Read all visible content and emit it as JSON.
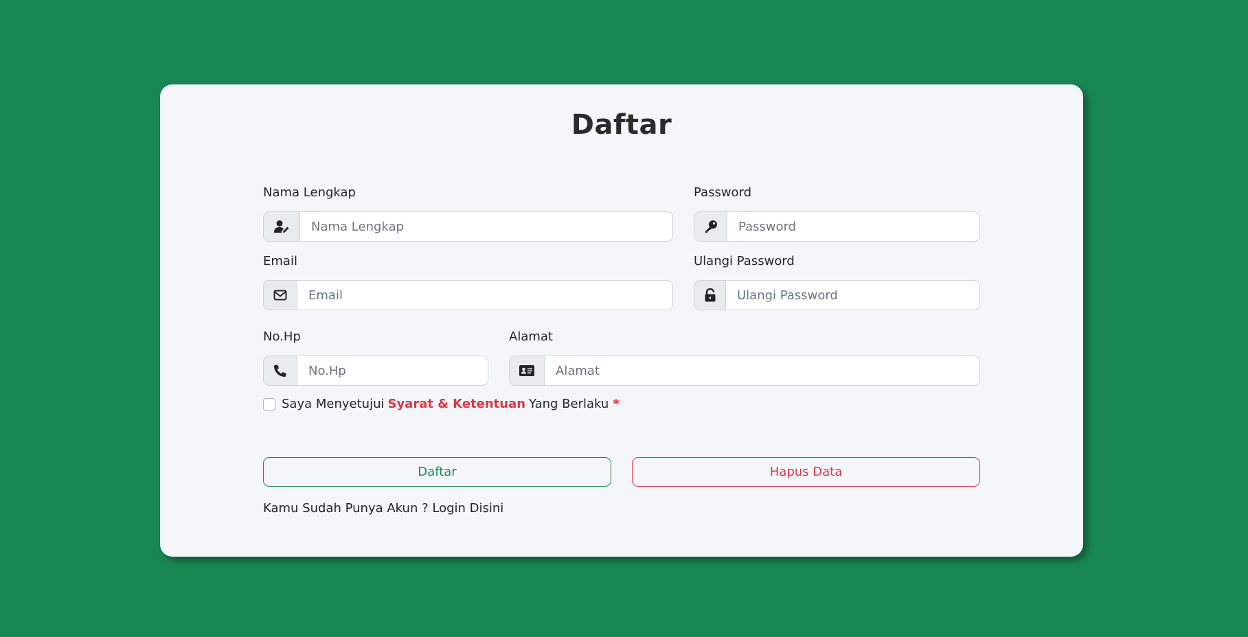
{
  "form": {
    "title": "Daftar",
    "fields": {
      "nama": {
        "label": "Nama Lengkap",
        "placeholder": "Nama Lengkap",
        "icon": "user-pen-icon"
      },
      "password": {
        "label": "Password",
        "placeholder": "Password",
        "icon": "key-icon"
      },
      "email": {
        "label": "Email",
        "placeholder": "Email",
        "icon": "envelope-icon"
      },
      "ulangi": {
        "label": "Ulangi Password",
        "placeholder": "Ulangi Password",
        "icon": "unlock-icon"
      },
      "nohp": {
        "label": "No.Hp",
        "placeholder": "No.Hp",
        "icon": "phone-icon"
      },
      "alamat": {
        "label": "Alamat",
        "placeholder": "Alamat",
        "icon": "id-card-icon"
      }
    },
    "terms": {
      "prefix": "Saya Menyetujui",
      "link": "Syarat & Ketentuan",
      "suffix": "Yang Berlaku",
      "required_mark": "*"
    },
    "buttons": {
      "submit": "Daftar",
      "reset": "Hapus Data"
    },
    "footer": {
      "text": "Kamu Sudah Punya Akun ?",
      "link": "Login Disini"
    }
  },
  "colors": {
    "background": "#198754",
    "card": "#f4f6f9",
    "success": "#198754",
    "danger": "#dc3545"
  }
}
